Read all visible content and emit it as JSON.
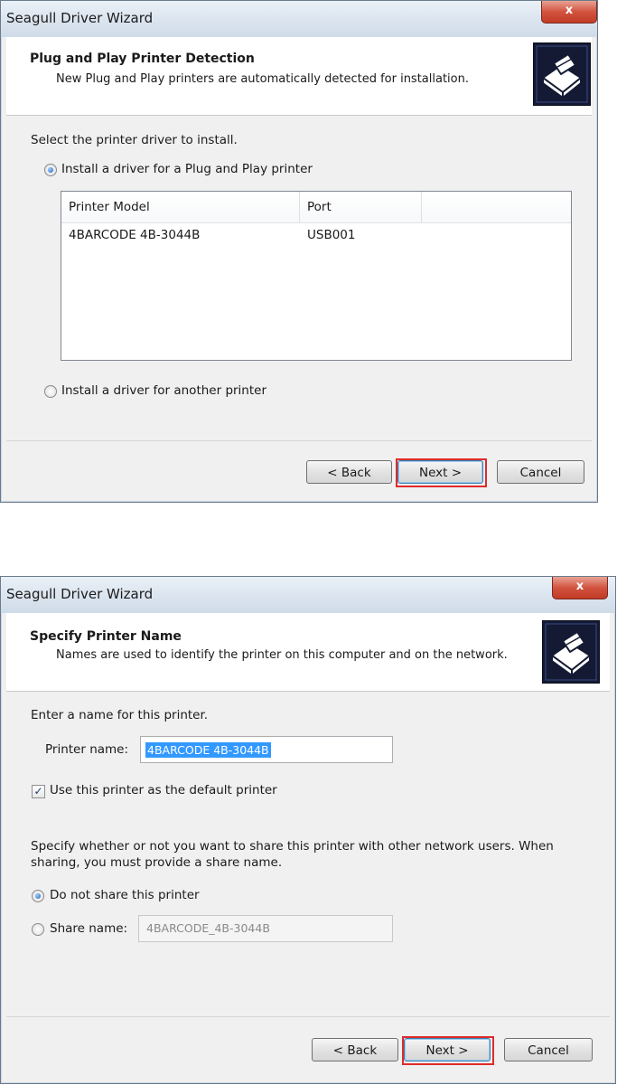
{
  "window1": {
    "title": "Seagull Driver Wizard",
    "close_label": "x",
    "header": {
      "title": "Plug and Play Printer Detection",
      "subtitle": "New Plug and Play printers are automatically detected for installation."
    },
    "instruction": "Select the printer driver to install.",
    "radio_pnp": {
      "label": "Install a driver for a Plug and Play printer",
      "selected": true
    },
    "list": {
      "columns": [
        "Printer Model",
        "Port"
      ],
      "rows": [
        {
          "model": "4BARCODE 4B-3044B",
          "port": "USB001"
        }
      ]
    },
    "radio_other": {
      "label": "Install a driver for another printer",
      "selected": false
    },
    "buttons": {
      "back": "< Back",
      "next": "Next >",
      "cancel": "Cancel"
    }
  },
  "window2": {
    "title": "Seagull Driver Wizard",
    "close_label": "x",
    "header": {
      "title": "Specify Printer Name",
      "subtitle": "Names are used to identify the printer on this computer and on the network."
    },
    "instruction": "Enter a name for this printer.",
    "printer_name_label": "Printer name:",
    "printer_name_value": "4BARCODE 4B-3044B",
    "default_checkbox": {
      "label": "Use this printer as the default printer",
      "checked": true
    },
    "share_instruction_line1": "Specify whether or not you want to share this printer with other network users.  When",
    "share_instruction_line2": "sharing, you must provide a share name.",
    "radio_no_share": {
      "label": "Do not share this printer",
      "selected": true
    },
    "radio_share": {
      "label": "Share name:",
      "selected": false
    },
    "share_name_value": "4BARCODE_4B-3044B",
    "buttons": {
      "back": "< Back",
      "next": "Next >",
      "cancel": "Cancel"
    }
  },
  "colors": {
    "highlight": "#e02a2a",
    "selection": "#3399ff",
    "close": "#c23b26"
  },
  "icons": [
    "close-icon",
    "printer-logo-icon",
    "radio-button-icon",
    "checkbox-check-icon"
  ]
}
